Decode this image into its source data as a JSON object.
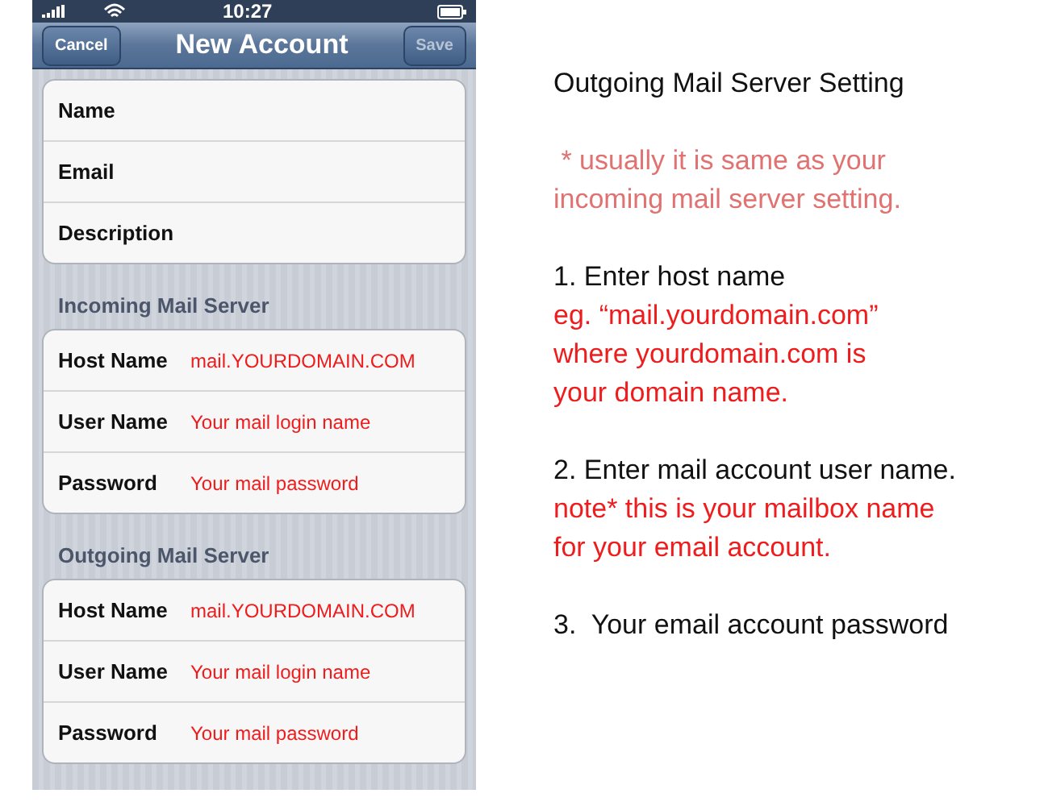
{
  "status_bar": {
    "time": "10:27"
  },
  "nav_bar": {
    "title": "New Account",
    "left_button": "Cancel",
    "right_button": "Save"
  },
  "sections": [
    {
      "rows": [
        {
          "label": "Name"
        },
        {
          "label": "Email"
        },
        {
          "label": "Description"
        }
      ]
    },
    {
      "header": "Incoming Mail Server",
      "rows": [
        {
          "label": "Host Name",
          "value": "mail.YOURDOMAIN.COM"
        },
        {
          "label": "User Name",
          "value": "Your mail login name"
        },
        {
          "label": "Password",
          "value": "Your mail password"
        }
      ]
    },
    {
      "header": "Outgoing Mail Server",
      "rows": [
        {
          "label": "Host Name",
          "value": "mail.YOURDOMAIN.COM"
        },
        {
          "label": "User Name",
          "value": "Your mail login name"
        },
        {
          "label": "Password",
          "value": "Your mail password"
        }
      ]
    }
  ],
  "notes": [
    {
      "lines": [
        {
          "text": "Outgoing Mail Server Setting",
          "kind": "plain"
        }
      ]
    },
    {
      "lines": [
        {
          "text": " * usually it is same as your",
          "kind": "hint"
        },
        {
          "text": "incoming mail server setting.",
          "kind": "hint"
        }
      ]
    },
    {
      "lines": [
        {
          "text": "1. Enter host name",
          "kind": "plain"
        },
        {
          "text": "eg. “mail.yourdomain.com”",
          "kind": "remark"
        },
        {
          "text": "where yourdomain.com is",
          "kind": "remark"
        },
        {
          "text": "your domain name.",
          "kind": "remark"
        }
      ]
    },
    {
      "lines": [
        {
          "text": "2. Enter mail account user name.",
          "kind": "plain"
        },
        {
          "text": "note* this is your mailbox name",
          "kind": "remark"
        },
        {
          "text": "for your email account.",
          "kind": "remark"
        }
      ]
    },
    {
      "lines": [
        {
          "text": "3.  Your email account password",
          "kind": "plain"
        }
      ]
    }
  ]
}
